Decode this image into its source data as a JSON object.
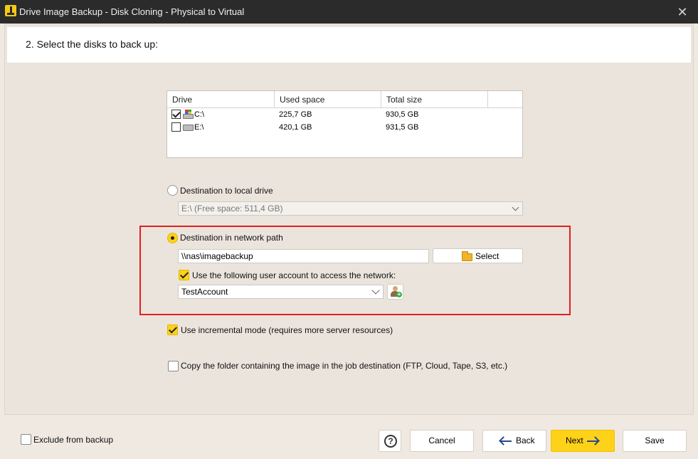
{
  "window": {
    "title": "Drive Image Backup - Disk Cloning - Physical to Virtual",
    "close_glyph": "✕"
  },
  "step": {
    "title": "2. Select the disks to back up:"
  },
  "drive_table": {
    "columns": [
      "Drive",
      "Used space",
      "Total size"
    ],
    "rows": [
      {
        "drive": "C:\\",
        "used": "225,7 GB",
        "total": "930,5 GB",
        "checked": true,
        "icon": "windows-drive-icon"
      },
      {
        "drive": "E:\\",
        "used": "420,1 GB",
        "total": "931,5 GB",
        "checked": false,
        "icon": "drive-icon"
      }
    ]
  },
  "local_destination": {
    "label": "Destination to local drive",
    "selected": false,
    "drive_value": "E:\\   (Free space: 511,4 GB)"
  },
  "network_destination": {
    "label": "Destination in network path",
    "selected": true,
    "path_value": "\\\\nas\\imagebackup",
    "select_label": "Select",
    "use_account_label": "Use the following user account to access the network:",
    "use_account_checked": true,
    "account_value": "TestAccount"
  },
  "options": {
    "incremental_label": "Use incremental mode (requires more server resources)",
    "incremental_checked": true,
    "copy_folder_label": "Copy the folder containing the image in the job destination (FTP, Cloud, Tape, S3, etc.)",
    "copy_folder_checked": false
  },
  "footer": {
    "exclude_label": "Exclude from backup",
    "help_glyph": "?",
    "cancel_label": "Cancel",
    "back_label": "Back",
    "next_label": "Next",
    "save_label": "Save"
  },
  "colors": {
    "accent": "#ffd21a",
    "highlight_frame": "#e02020",
    "titlebar": "#2b2b2b"
  }
}
